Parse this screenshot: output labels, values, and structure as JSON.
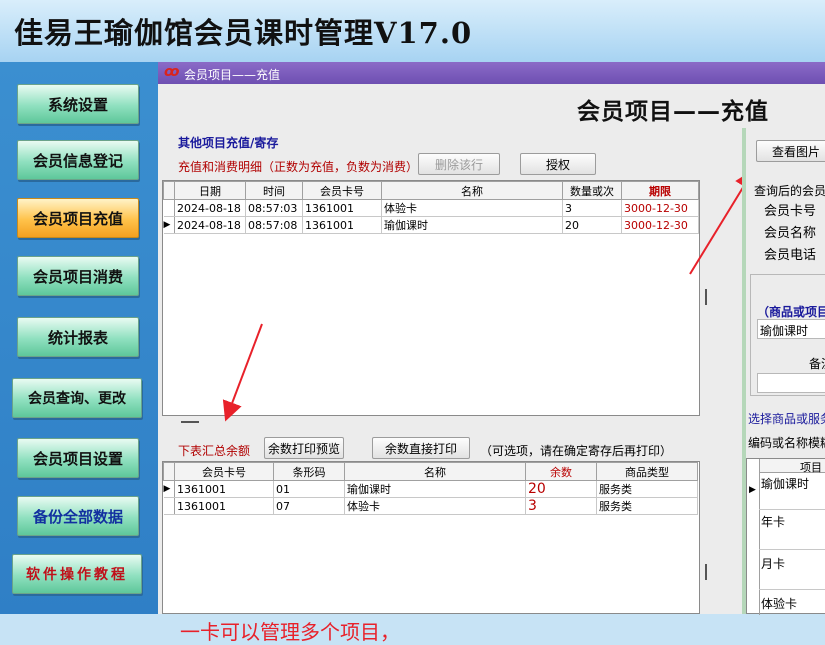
{
  "app": {
    "title": "佳易王瑜伽馆会员课时管理V17.0"
  },
  "sidebar": {
    "items": [
      {
        "label": "系统设置"
      },
      {
        "label": "会员信息登记"
      },
      {
        "label": "会员项目充值"
      },
      {
        "label": "会员项目消费"
      },
      {
        "label": "统计报表"
      },
      {
        "label": "会员查询、更改"
      },
      {
        "label": "会员项目设置"
      },
      {
        "label": "备份全部数据"
      },
      {
        "label": "软件操作教程"
      }
    ]
  },
  "window": {
    "title": "会员项目——充值",
    "heading": "会员项目——充值"
  },
  "recharge": {
    "section_title": "其他项目充值/寄存",
    "hint": "充值和消费明细（正数为充值，负数为消费）",
    "delete_label": "删除该行",
    "authorize_label": "授权",
    "columns": [
      "日期",
      "时间",
      "会员卡号",
      "名称",
      "数量或次",
      "期限"
    ],
    "rows": [
      {
        "date": "2024-08-18",
        "time": "08:57:03",
        "card": "1361001",
        "name": "体验卡",
        "qty": "3",
        "expiry": "3000-12-30"
      },
      {
        "date": "2024-08-18",
        "time": "08:57:08",
        "card": "1361001",
        "name": "瑜伽课时",
        "qty": "20",
        "expiry": "3000-12-30"
      }
    ]
  },
  "balance": {
    "label": "下表汇总余额",
    "preview_label": "余数打印预览",
    "print_label": "余数直接打印",
    "optional_note": "（可选项，请在确定寄存后再打印）",
    "columns": [
      "会员卡号",
      "条形码",
      "名称",
      "余数",
      "商品类型"
    ],
    "rows": [
      {
        "card": "1361001",
        "barcode": "01",
        "name": "瑜伽课时",
        "remain": "20",
        "type": "服务类"
      },
      {
        "card": "1361001",
        "barcode": "07",
        "name": "体验卡",
        "remain": "3",
        "type": "服务类"
      }
    ]
  },
  "annotation": {
    "text": "一卡可以管理多个项目，"
  },
  "right": {
    "view_image_label": "查看图片",
    "query_title": "查询后的会员",
    "card_label": "会员卡号",
    "name_label": "会员名称",
    "phone_label": "会员电话",
    "goods_title": "（商品或项目",
    "goods_value": "瑜伽课时",
    "note_label": "备注",
    "select_label": "选择商品或服务",
    "filter_label": "编码或名称模糊",
    "list_header": "项目",
    "list_items": [
      "瑜伽课时",
      "年卡",
      "月卡",
      "体验卡"
    ]
  },
  "colors": {
    "accent_red": "#e8212a",
    "title_bar": "#6e4fb2",
    "active_button": "#ffc24a"
  }
}
